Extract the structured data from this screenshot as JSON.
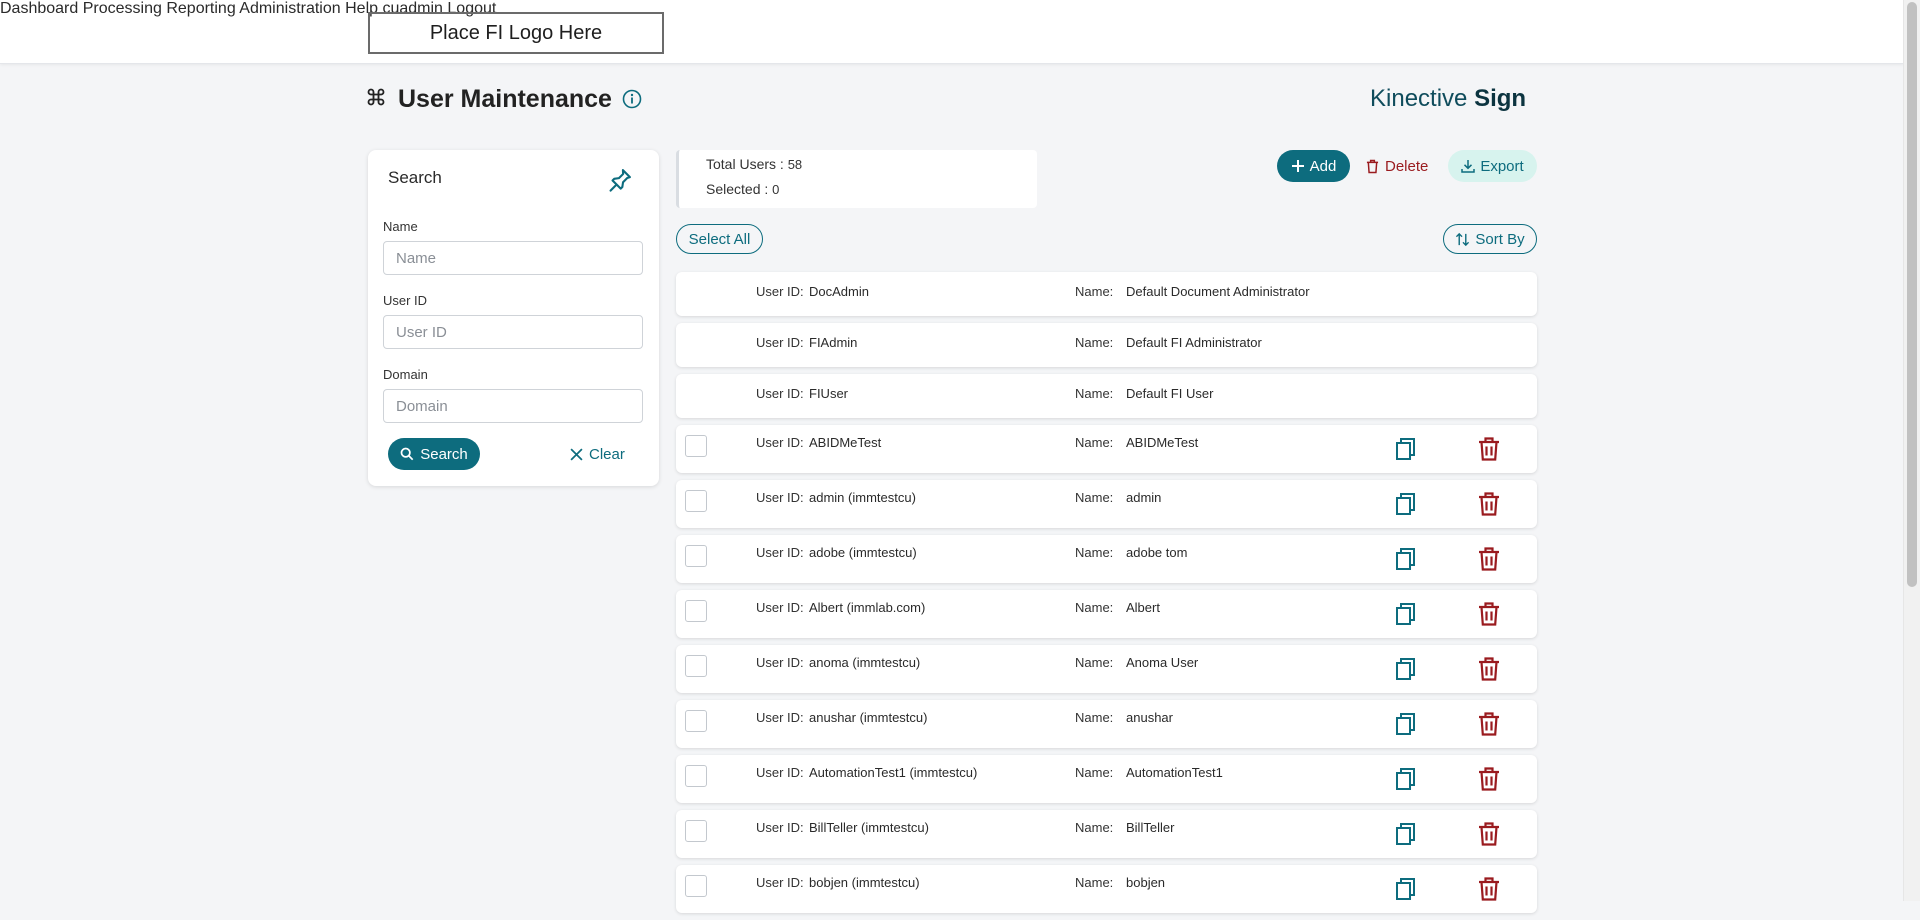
{
  "header": {
    "logo_text": "Place FI Logo Here",
    "nav": [
      "Dashboard",
      "Processing",
      "Reporting",
      "Administration",
      "Help",
      "cuadmin",
      "Logout"
    ]
  },
  "page": {
    "title": "User Maintenance",
    "brand_light": "Kinective ",
    "brand_bold": "Sign"
  },
  "search": {
    "title": "Search",
    "name_label": "Name",
    "name_placeholder": "Name",
    "userid_label": "User ID",
    "userid_placeholder": "User ID",
    "domain_label": "Domain",
    "domain_placeholder": "Domain",
    "search_button": "Search",
    "clear_button": "Clear"
  },
  "summary": {
    "total_label": "Total Users : ",
    "total_value": "58",
    "selected_label": "Selected : ",
    "selected_value": "0"
  },
  "actions": {
    "add": "Add",
    "delete": "Delete",
    "export": "Export",
    "select_all": "Select All",
    "sort_by": "Sort By"
  },
  "labels": {
    "user_id": "User ID:",
    "name": "Name:"
  },
  "colors": {
    "primary": "#0d6c7e",
    "danger": "#9a1b1f",
    "export_bg": "#d7f3ee"
  },
  "system_users": [
    {
      "user_id": "DocAdmin",
      "name": "Default Document Administrator"
    },
    {
      "user_id": "FIAdmin",
      "name": "Default FI Administrator"
    },
    {
      "user_id": "FIUser",
      "name": "Default FI User"
    }
  ],
  "users": [
    {
      "user_id": "ABIDMeTest",
      "name": "ABIDMeTest"
    },
    {
      "user_id": "admin (immtestcu)",
      "name": "admin"
    },
    {
      "user_id": "adobe (immtestcu)",
      "name": "adobe tom"
    },
    {
      "user_id": "Albert (immlab.com)",
      "name": "Albert"
    },
    {
      "user_id": "anoma (immtestcu)",
      "name": "Anoma User"
    },
    {
      "user_id": "anushar (immtestcu)",
      "name": "anushar"
    },
    {
      "user_id": "AutomationTest1 (immtestcu)",
      "name": "AutomationTest1"
    },
    {
      "user_id": "BillTeller (immtestcu)",
      "name": "BillTeller"
    },
    {
      "user_id": "bobjen (immtestcu)",
      "name": "bobjen"
    }
  ]
}
